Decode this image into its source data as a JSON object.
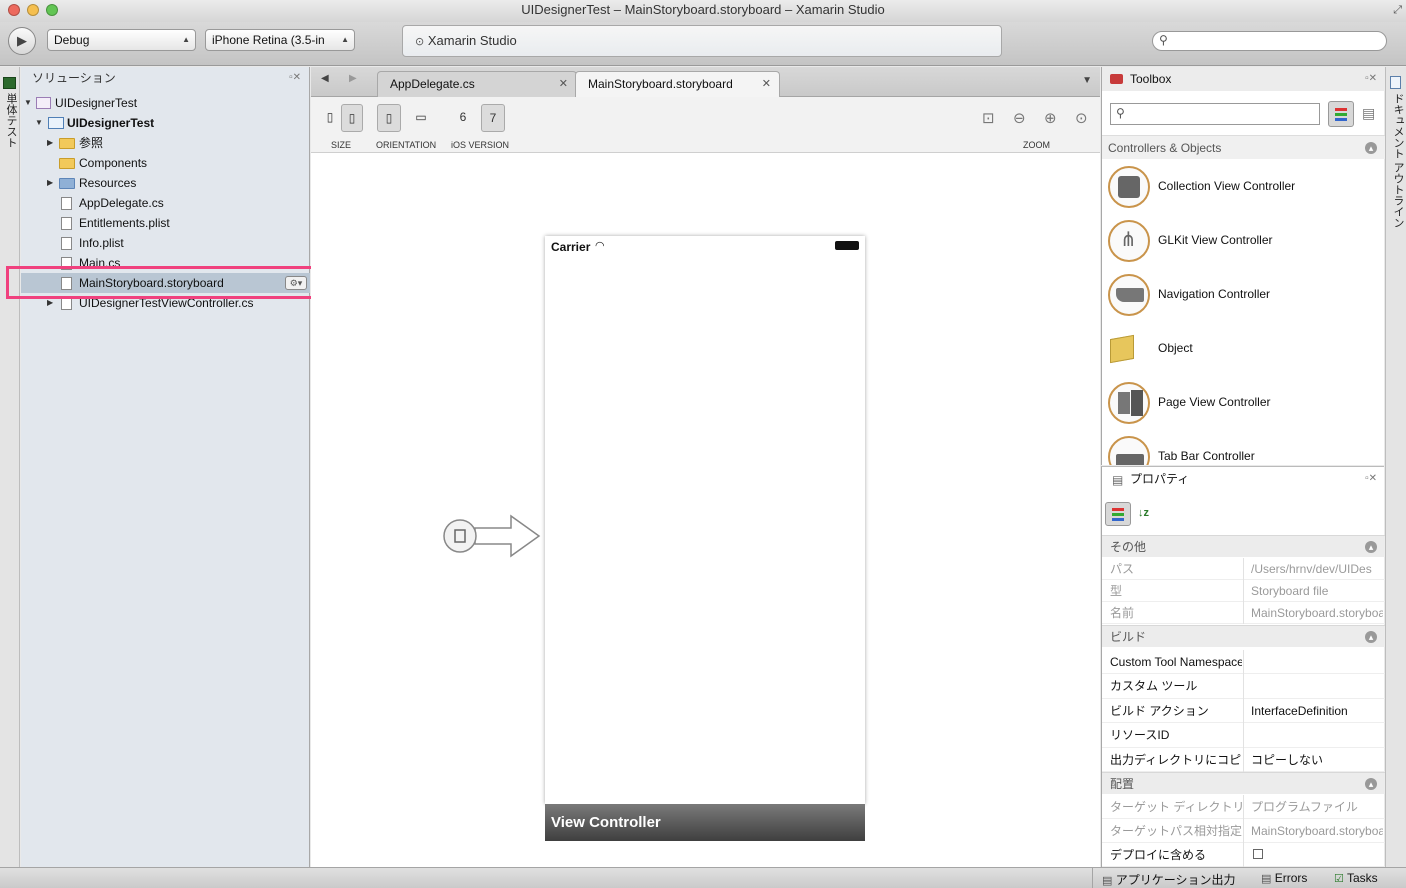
{
  "window": {
    "title": "UIDesignerTest – MainStoryboard.storyboard – Xamarin Studio"
  },
  "toolbar": {
    "config": "Debug",
    "device": "iPhone Retina (3.5-in",
    "status": "Xamarin Studio",
    "search_placeholder": ""
  },
  "left_strip": {
    "label": "単体テスト"
  },
  "right_strip": {
    "label": "ドキュメント アウトライン"
  },
  "solution": {
    "title": "ソリューション",
    "items": [
      {
        "label": "UIDesignerTest"
      },
      {
        "label": "UIDesignerTest"
      },
      {
        "label": "参照"
      },
      {
        "label": "Components"
      },
      {
        "label": "Resources"
      },
      {
        "label": "AppDelegate.cs"
      },
      {
        "label": "Entitlements.plist"
      },
      {
        "label": "Info.plist"
      },
      {
        "label": "Main.cs"
      },
      {
        "label": "MainStoryboard.storyboard"
      },
      {
        "label": "UIDesignerTestViewController.cs"
      }
    ]
  },
  "editor": {
    "tabs": [
      {
        "label": "AppDelegate.cs"
      },
      {
        "label": "MainStoryboard.storyboard"
      }
    ],
    "tab_close": "✕",
    "designer": {
      "size_label": "SIZE",
      "orientation_label": "ORIENTATION",
      "ios_version_label": "iOS VERSION",
      "ios6": "6",
      "ios7": "7",
      "zoom_label": "ZOOM"
    },
    "phone": {
      "carrier": "Carrier",
      "controller_name": "View Controller"
    }
  },
  "toolbox": {
    "title": "Toolbox",
    "search_placeholder": "",
    "category": "Controllers & Objects",
    "items": [
      {
        "label": "Collection View Controller"
      },
      {
        "label": "GLKit View Controller"
      },
      {
        "label": "Navigation Controller"
      },
      {
        "label": "Object"
      },
      {
        "label": "Page View Controller"
      },
      {
        "label": "Tab Bar Controller"
      }
    ]
  },
  "properties": {
    "title": "プロパティ",
    "sections": [
      {
        "name": "その他",
        "rows": [
          {
            "key": "パス",
            "value": "/Users/hrnv/dev/UIDes"
          },
          {
            "key": "型",
            "value": "Storyboard file"
          },
          {
            "key": "名前",
            "value": "MainStoryboard.storyboard"
          }
        ]
      },
      {
        "name": "ビルド",
        "rows": [
          {
            "key": "Custom Tool Namespace",
            "value": ""
          },
          {
            "key": "カスタム ツール",
            "value": ""
          },
          {
            "key": "ビルド アクション",
            "value": "InterfaceDefinition"
          },
          {
            "key": "リソースID",
            "value": ""
          },
          {
            "key": "出力ディレクトリにコピー",
            "value": "コピーしない"
          }
        ]
      },
      {
        "name": "配置",
        "rows": [
          {
            "key": "ターゲット ディレクトリ",
            "value": "プログラムファイル"
          },
          {
            "key": "ターゲットパス相対指定",
            "value": "MainStoryboard.storyboard"
          },
          {
            "key": "デプロイに含める",
            "value": ""
          }
        ]
      }
    ]
  },
  "statusbar": {
    "app_output": "アプリケーション出力",
    "errors": "Errors",
    "tasks": "Tasks"
  },
  "colors": {
    "highlight": "#f0417e",
    "selection": "#b9c6d3",
    "accent": "#c9944b"
  }
}
